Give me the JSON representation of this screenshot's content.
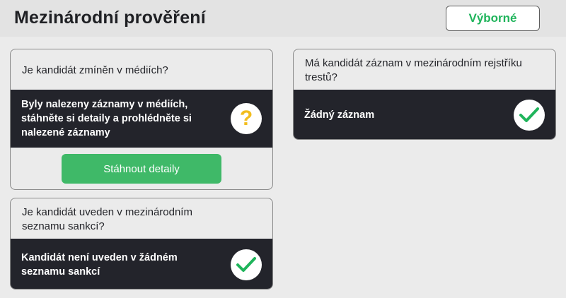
{
  "header": {
    "title": "Mezinárodní prověření",
    "rating": "Výborné"
  },
  "colors": {
    "success": "#1fb45b",
    "warning": "#f2bd1e",
    "button": "#3fb968",
    "dark_bar": "#23242b"
  },
  "media_card": {
    "question": "Je kandidát zmíněn v médiích?",
    "result": "Byly nalezeny záznamy v médiích, stáhněte si detaily a prohlédněte si nalezené záznamy",
    "status_icon": "question-icon",
    "button_label": "Stáhnout detaily"
  },
  "sanctions_card": {
    "question": "Je kandidát uveden v mezinárodním seznamu sankcí?",
    "result": "Kandidát není uveden v žádném seznamu sankcí",
    "status_icon": "checkmark-icon"
  },
  "criminal_card": {
    "question": "Má kandidát záznam v mezinárodním rejstříku trestů?",
    "result": "Žádný záznam",
    "status_icon": "checkmark-icon"
  }
}
